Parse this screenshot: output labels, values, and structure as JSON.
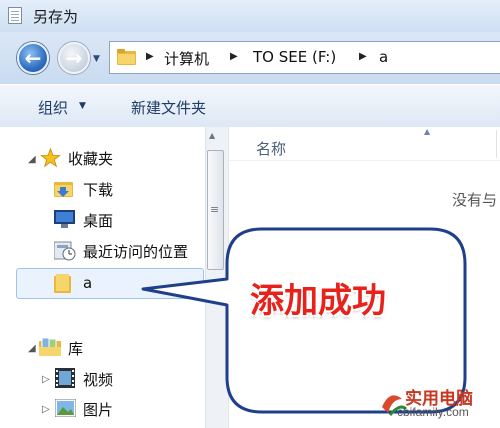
{
  "window": {
    "title": "另存为"
  },
  "address": {
    "segments": [
      "计算机",
      "TO  SEE (F:)",
      "a"
    ]
  },
  "toolbar": {
    "organize_label": "组织",
    "new_folder_label": "新建文件夹"
  },
  "tree": {
    "favorites_label": "收藏夹",
    "downloads_label": "下载",
    "desktop_label": "桌面",
    "recent_label": "最近访问的位置",
    "folder_a_label": "a",
    "library_label": "库",
    "videos_label": "视频",
    "pictures_label": "图片"
  },
  "content": {
    "column_name": "名称",
    "empty_message": "没有与"
  },
  "callout": {
    "text": "添加成功"
  },
  "watermark": {
    "main": "实用电脑",
    "sub": "cbifamily.com"
  },
  "colors": {
    "accent": "#3a8ee6",
    "callout_text": "#e8221a",
    "callout_border": "#1f3f8a"
  },
  "icons": {
    "back": "back-arrow-icon",
    "forward": "forward-arrow-icon",
    "folder": "folder-icon",
    "star": "star-icon",
    "download": "download-folder-icon",
    "desktop": "desktop-icon",
    "recent": "recent-places-icon",
    "library": "library-icon",
    "videos": "video-icon",
    "pictures": "picture-icon"
  }
}
